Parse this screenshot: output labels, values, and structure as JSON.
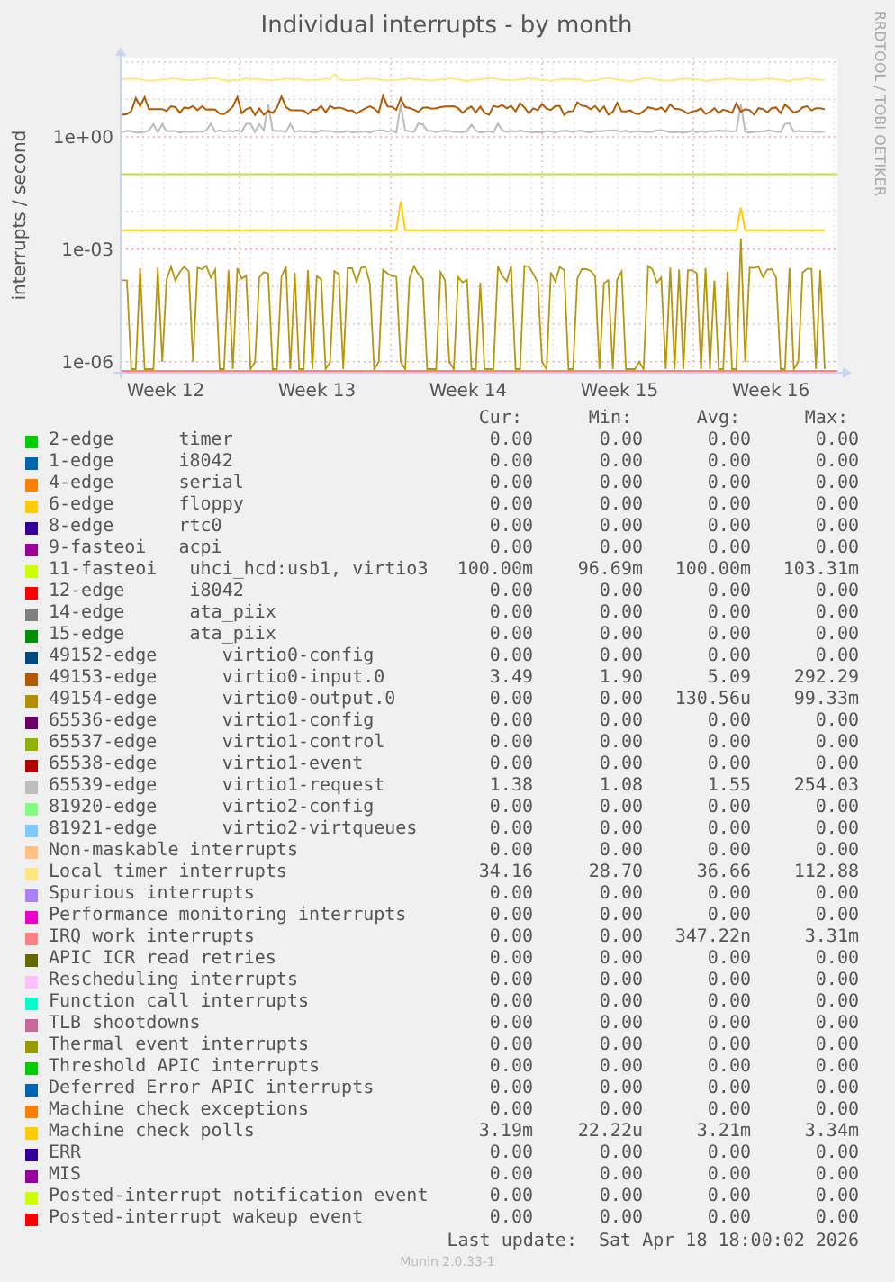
{
  "graph": {
    "title": "Individual interrupts - by month",
    "watermark": "RRDTOOL / TOBI OETIKER",
    "ylabel": "interrupts / second",
    "xticks": [
      "Week 12",
      "Week 13",
      "Week 14",
      "Week 15",
      "Week 16"
    ],
    "yticks": [
      "1e+00",
      "1e-03",
      "1e-06"
    ]
  },
  "legend": {
    "columns": [
      "Cur:",
      "Min:",
      "Avg:",
      "Max:"
    ],
    "items": [
      {
        "label": "2-edge      timer",
        "color": "#00cc00",
        "cur": "0.00",
        "min": "0.00",
        "avg": "0.00",
        "max": "0.00"
      },
      {
        "label": "1-edge      i8042",
        "color": "#0066b3",
        "cur": "0.00",
        "min": "0.00",
        "avg": "0.00",
        "max": "0.00"
      },
      {
        "label": "4-edge      serial",
        "color": "#ff8000",
        "cur": "0.00",
        "min": "0.00",
        "avg": "0.00",
        "max": "0.00"
      },
      {
        "label": "6-edge      floppy",
        "color": "#ffcc00",
        "cur": "0.00",
        "min": "0.00",
        "avg": "0.00",
        "max": "0.00"
      },
      {
        "label": "8-edge      rtc0",
        "color": "#330099",
        "cur": "0.00",
        "min": "0.00",
        "avg": "0.00",
        "max": "0.00"
      },
      {
        "label": "9-fasteoi   acpi",
        "color": "#990099",
        "cur": "0.00",
        "min": "0.00",
        "avg": "0.00",
        "max": "0.00"
      },
      {
        "label": "11-fasteoi   uhci_hcd:usb1, virtio3",
        "color": "#ccff00",
        "cur": "100.00m",
        "min": "96.69m",
        "avg": "100.00m",
        "max": "103.31m"
      },
      {
        "label": "12-edge      i8042",
        "color": "#ff0000",
        "cur": "0.00",
        "min": "0.00",
        "avg": "0.00",
        "max": "0.00"
      },
      {
        "label": "14-edge      ata_piix",
        "color": "#808080",
        "cur": "0.00",
        "min": "0.00",
        "avg": "0.00",
        "max": "0.00"
      },
      {
        "label": "15-edge      ata_piix",
        "color": "#008f00",
        "cur": "0.00",
        "min": "0.00",
        "avg": "0.00",
        "max": "0.00"
      },
      {
        "label": "49152-edge      virtio0-config",
        "color": "#00487d",
        "cur": "0.00",
        "min": "0.00",
        "avg": "0.00",
        "max": "0.00"
      },
      {
        "label": "49153-edge      virtio0-input.0",
        "color": "#b35a00",
        "cur": "3.49",
        "min": "1.90",
        "avg": "5.09",
        "max": "292.29"
      },
      {
        "label": "49154-edge      virtio0-output.0",
        "color": "#b38f00",
        "cur": "0.00",
        "min": "0.00",
        "avg": "130.56u",
        "max": "99.33m"
      },
      {
        "label": "65536-edge      virtio1-config",
        "color": "#6b006b",
        "cur": "0.00",
        "min": "0.00",
        "avg": "0.00",
        "max": "0.00"
      },
      {
        "label": "65537-edge      virtio1-control",
        "color": "#8fb300",
        "cur": "0.00",
        "min": "0.00",
        "avg": "0.00",
        "max": "0.00"
      },
      {
        "label": "65538-edge      virtio1-event",
        "color": "#b30000",
        "cur": "0.00",
        "min": "0.00",
        "avg": "0.00",
        "max": "0.00"
      },
      {
        "label": "65539-edge      virtio1-request",
        "color": "#bebebe",
        "cur": "1.38",
        "min": "1.08",
        "avg": "1.55",
        "max": "254.03"
      },
      {
        "label": "81920-edge      virtio2-config",
        "color": "#80ff80",
        "cur": "0.00",
        "min": "0.00",
        "avg": "0.00",
        "max": "0.00"
      },
      {
        "label": "81921-edge      virtio2-virtqueues",
        "color": "#80c9ff",
        "cur": "0.00",
        "min": "0.00",
        "avg": "0.00",
        "max": "0.00"
      },
      {
        "label": "Non-maskable interrupts",
        "color": "#ffc080",
        "cur": "0.00",
        "min": "0.00",
        "avg": "0.00",
        "max": "0.00"
      },
      {
        "label": "Local timer interrupts",
        "color": "#ffe680",
        "cur": "34.16",
        "min": "28.70",
        "avg": "36.66",
        "max": "112.88"
      },
      {
        "label": "Spurious interrupts",
        "color": "#aa80ff",
        "cur": "0.00",
        "min": "0.00",
        "avg": "0.00",
        "max": "0.00"
      },
      {
        "label": "Performance monitoring interrupts",
        "color": "#ee00cc",
        "cur": "0.00",
        "min": "0.00",
        "avg": "0.00",
        "max": "0.00"
      },
      {
        "label": "IRQ work interrupts",
        "color": "#ff8080",
        "cur": "0.00",
        "min": "0.00",
        "avg": "347.22n",
        "max": "3.31m"
      },
      {
        "label": "APIC ICR read retries",
        "color": "#666600",
        "cur": "0.00",
        "min": "0.00",
        "avg": "0.00",
        "max": "0.00"
      },
      {
        "label": "Rescheduling interrupts",
        "color": "#ffbfff",
        "cur": "0.00",
        "min": "0.00",
        "avg": "0.00",
        "max": "0.00"
      },
      {
        "label": "Function call interrupts",
        "color": "#00ffcc",
        "cur": "0.00",
        "min": "0.00",
        "avg": "0.00",
        "max": "0.00"
      },
      {
        "label": "TLB shootdowns",
        "color": "#cc6699",
        "cur": "0.00",
        "min": "0.00",
        "avg": "0.00",
        "max": "0.00"
      },
      {
        "label": "Thermal event interrupts",
        "color": "#999900",
        "cur": "0.00",
        "min": "0.00",
        "avg": "0.00",
        "max": "0.00"
      },
      {
        "label": "Threshold APIC interrupts",
        "color": "#00cc00",
        "cur": "0.00",
        "min": "0.00",
        "avg": "0.00",
        "max": "0.00"
      },
      {
        "label": "Deferred Error APIC interrupts",
        "color": "#0066b3",
        "cur": "0.00",
        "min": "0.00",
        "avg": "0.00",
        "max": "0.00"
      },
      {
        "label": "Machine check exceptions",
        "color": "#ff8000",
        "cur": "0.00",
        "min": "0.00",
        "avg": "0.00",
        "max": "0.00"
      },
      {
        "label": "Machine check polls",
        "color": "#ffcc00",
        "cur": "3.19m",
        "min": "22.22u",
        "avg": "3.21m",
        "max": "3.34m"
      },
      {
        "label": "ERR",
        "color": "#330099",
        "cur": "0.00",
        "min": "0.00",
        "avg": "0.00",
        "max": "0.00"
      },
      {
        "label": "MIS",
        "color": "#990099",
        "cur": "0.00",
        "min": "0.00",
        "avg": "0.00",
        "max": "0.00"
      },
      {
        "label": "Posted-interrupt notification event",
        "color": "#ccff00",
        "cur": "0.00",
        "min": "0.00",
        "avg": "0.00",
        "max": "0.00"
      },
      {
        "label": "Posted-interrupt wakeup event",
        "color": "#ff0000",
        "cur": "0.00",
        "min": "0.00",
        "avg": "0.00",
        "max": "0.00"
      }
    ]
  },
  "last_update": "Last update:  Sat Apr 18 18:00:02 2026",
  "version": "Munin 2.0.33-1"
}
